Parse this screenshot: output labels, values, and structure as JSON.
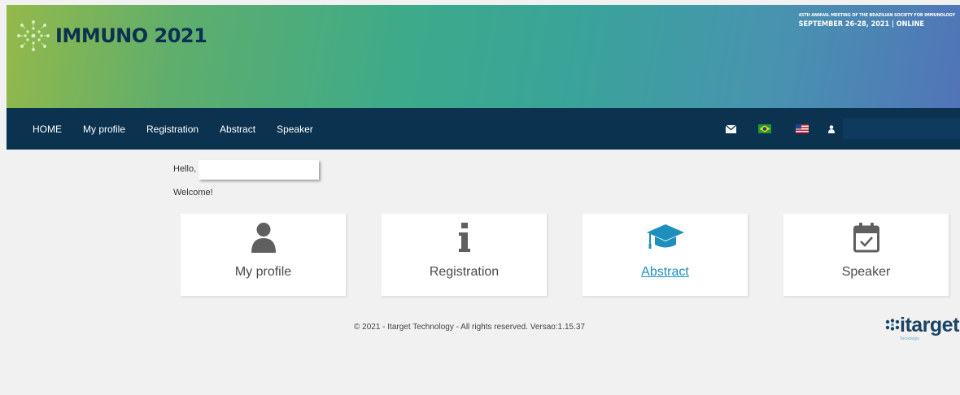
{
  "header": {
    "logo_text": "IMMUNO 2021",
    "event_line1": "45TH ANNUAL MEETING OF THE BRAZILIAN SOCIETY FOR IMMUNOLOGY",
    "event_line2": "SEPTEMBER 26-28, 2021 | ONLINE"
  },
  "nav": {
    "items": [
      "HOME",
      "My profile",
      "Registration",
      "Abstract",
      "Speaker"
    ],
    "icons": [
      "envelope-icon",
      "brazil-flag-icon",
      "usa-flag-icon",
      "user-icon"
    ]
  },
  "greeting": {
    "hello": "Hello,",
    "welcome": "Welcome!"
  },
  "cards": [
    {
      "label": "My profile",
      "icon": "user-icon"
    },
    {
      "label": "Registration",
      "icon": "info-icon"
    },
    {
      "label": "Abstract",
      "icon": "graduation-cap-icon"
    },
    {
      "label": "Speaker",
      "icon": "calendar-check-icon"
    }
  ],
  "footer": {
    "copyright": "© 2021 - Itarget Technology - All rights reserved. Versao:1.15.37",
    "brand": "itarget",
    "brand_sub": "Tecnologia"
  },
  "colors": {
    "navbar": "#0b3350",
    "icon_gray": "#5f5f5f",
    "abstract_accent": "#1a8fbf"
  }
}
